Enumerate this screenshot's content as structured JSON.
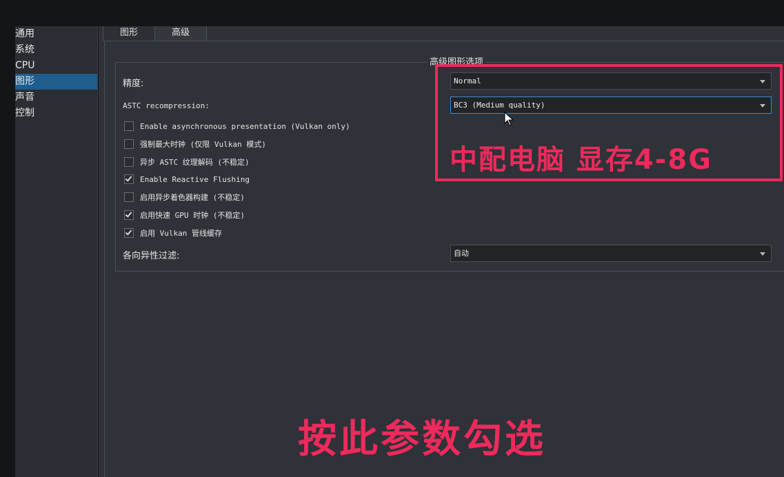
{
  "sidebar": {
    "items": [
      {
        "label": "通用",
        "active": false
      },
      {
        "label": "系统",
        "active": false
      },
      {
        "label": "CPU",
        "active": false
      },
      {
        "label": "图形",
        "active": true
      },
      {
        "label": "声音",
        "active": false
      },
      {
        "label": "控制",
        "active": false
      }
    ]
  },
  "tabs": [
    {
      "label": "图形",
      "active": false
    },
    {
      "label": "高级",
      "active": true
    }
  ],
  "group": {
    "title": "高级图形选项",
    "accuracy_label": "精度:",
    "accuracy_value": "Normal",
    "astc_label": "ASTC recompression:",
    "astc_value": "BC3 (Medium quality)",
    "anisotropic_label": "各向异性过滤:",
    "anisotropic_value": "自动",
    "checkboxes": [
      {
        "label": "Enable asynchronous presentation (Vulkan only)",
        "checked": false
      },
      {
        "label": "强制最大时钟 (仅限 Vulkan 模式)",
        "checked": false
      },
      {
        "label": "异步 ASTC 纹理解码 (不稳定)",
        "checked": false
      },
      {
        "label": "Enable Reactive Flushing",
        "checked": true
      },
      {
        "label": "启用异步着色器构建 (不稳定)",
        "checked": false
      },
      {
        "label": "启用快速 GPU 时钟 (不稳定)",
        "checked": true
      },
      {
        "label": "启用 Vulkan 管线缓存",
        "checked": true
      }
    ]
  },
  "overlay": {
    "top_text": "中配电脑 显存4-8G",
    "bottom_text": "按此参数勾选",
    "accent_color": "#ee2a5c"
  },
  "icons": {
    "dropdown": "chevron-down-icon",
    "check": "check-icon",
    "cursor": "mouse-pointer-icon"
  }
}
